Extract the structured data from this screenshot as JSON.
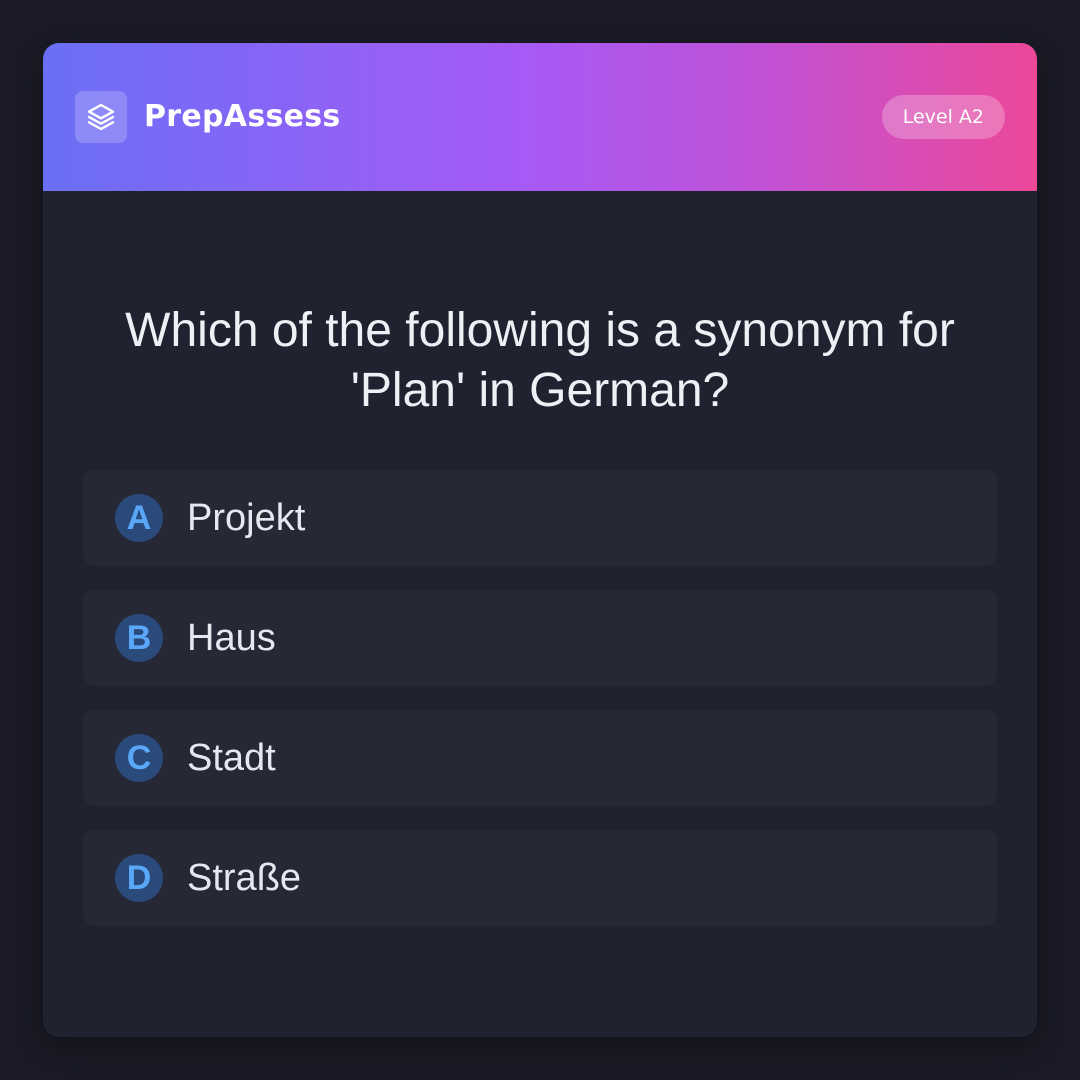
{
  "header": {
    "brand": "PrepAssess",
    "logo_icon": "layers-icon",
    "level_badge": "Level A2",
    "gradient": [
      "#6a6ff5",
      "#a65af7",
      "#ec4899"
    ]
  },
  "question": {
    "line1": "Which of the following is a synonym for",
    "line2": "'Plan' in German?"
  },
  "options": [
    {
      "letter": "A",
      "label": "Projekt"
    },
    {
      "letter": "B",
      "label": "Haus"
    },
    {
      "letter": "C",
      "label": "Stadt"
    },
    {
      "letter": "D",
      "label": "Straße"
    }
  ],
  "colors": {
    "page_bg": "#1a1b26",
    "card_bg": "#202230",
    "option_bg": "#262836",
    "letter_bg": "#2b4a7c",
    "letter_fg": "#5aa6f8"
  }
}
